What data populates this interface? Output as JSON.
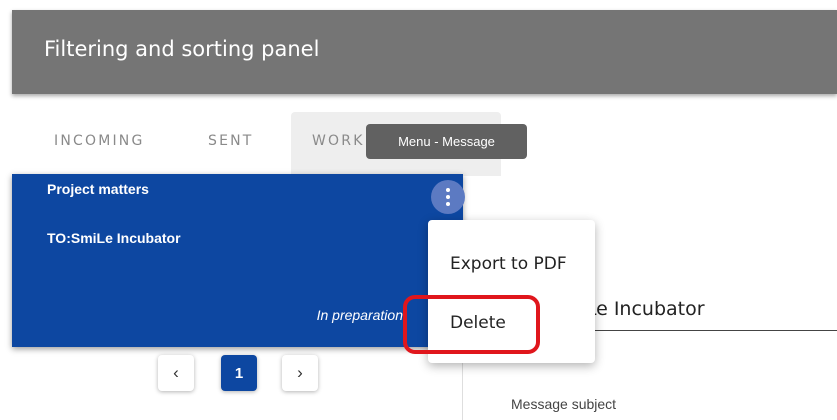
{
  "header": {
    "title": "Filtering and sorting panel"
  },
  "tabs": [
    {
      "label": "INCOMING"
    },
    {
      "label": "SENT"
    },
    {
      "label": "WORKING"
    }
  ],
  "tooltip": {
    "text": "Menu - Message"
  },
  "message_card": {
    "subject": "Project matters",
    "recipient": "TO:SmiLe Incubator",
    "status": "In preparation"
  },
  "context_menu": {
    "items": [
      {
        "label": "Export to PDF"
      },
      {
        "label": "Delete"
      }
    ]
  },
  "detail_panel": {
    "recipient_value": "SmiLe Incubator",
    "message_subject_label": "Message subject"
  },
  "pagination": {
    "prev_glyph": "‹",
    "current_page": "1",
    "next_glyph": "›"
  },
  "colors": {
    "header_bg": "#757575",
    "card_bg": "#0d47a1",
    "highlight": "#e0161c"
  }
}
